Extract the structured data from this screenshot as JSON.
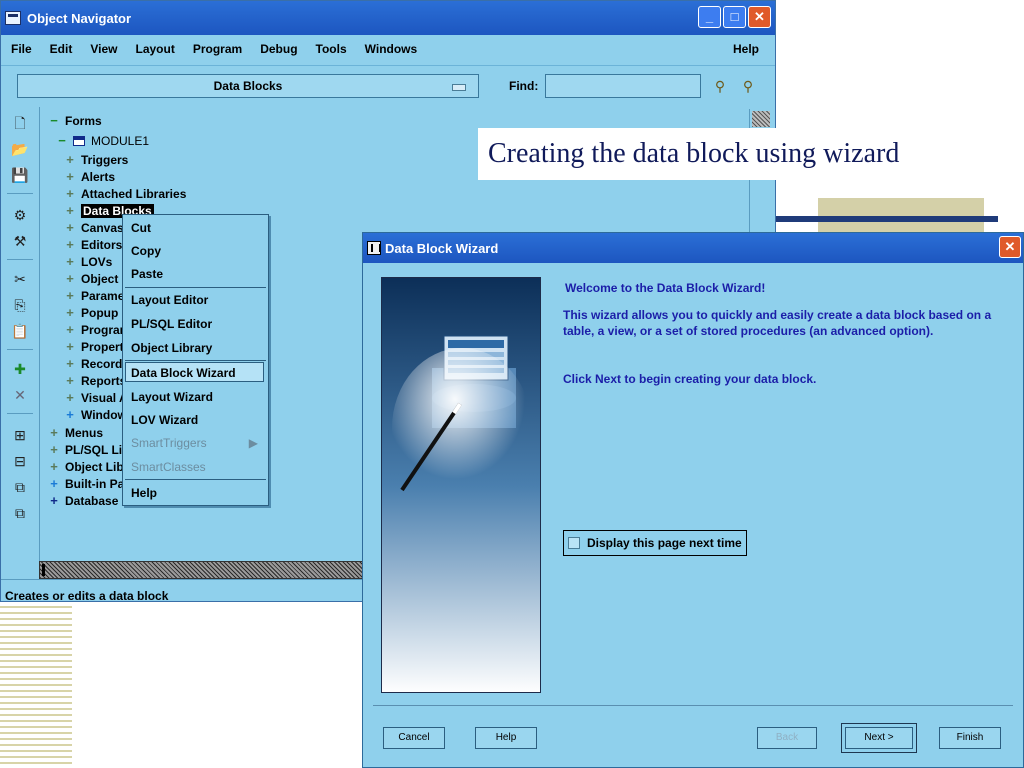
{
  "slide": {
    "title": "Creating the data block using wizard"
  },
  "navigator": {
    "title": "Object Navigator",
    "menu": [
      "File",
      "Edit",
      "View",
      "Layout",
      "Program",
      "Debug",
      "Tools",
      "Windows"
    ],
    "menu_help": "Help",
    "block_selector": "Data Blocks",
    "find_label": "Find:",
    "find_value": "",
    "status": "Creates or edits a data block",
    "tree": {
      "forms": "Forms",
      "module": "MODULE1",
      "children": [
        "Triggers",
        "Alerts",
        "Attached Libraries",
        "Data Blocks",
        "Canvases",
        "Editors",
        "LOVs",
        "Object Groups",
        "Parameters",
        "Popup Menus",
        "Program Units",
        "Property Classes",
        "Record Groups",
        "Reports",
        "Visual Attributes",
        "Windows"
      ],
      "top_nodes": [
        "Menus",
        "PL/SQL Libraries",
        "Object Libraries",
        "Built-in Packages",
        "Database Objects"
      ]
    }
  },
  "context_menu": {
    "items": [
      "Cut",
      "Copy",
      "Paste",
      "Layout Editor",
      "PL/SQL Editor",
      "Object Library",
      "Data Block Wizard",
      "Layout Wizard",
      "LOV Wizard",
      "SmartTriggers",
      "SmartClasses",
      "Help"
    ]
  },
  "wizard": {
    "title": "Data Block Wizard",
    "heading": "Welcome to the Data Block Wizard!",
    "para1": "This wizard allows you to quickly and easily create a data block based on a table, a view, or a set of stored procedures (an advanced option).",
    "para2": "Click Next to begin creating your data block.",
    "checkbox_label": "Display this page next time",
    "buttons": {
      "cancel": "Cancel",
      "help": "Help",
      "back": "Back",
      "next": "Next >",
      "finish": "Finish"
    }
  }
}
